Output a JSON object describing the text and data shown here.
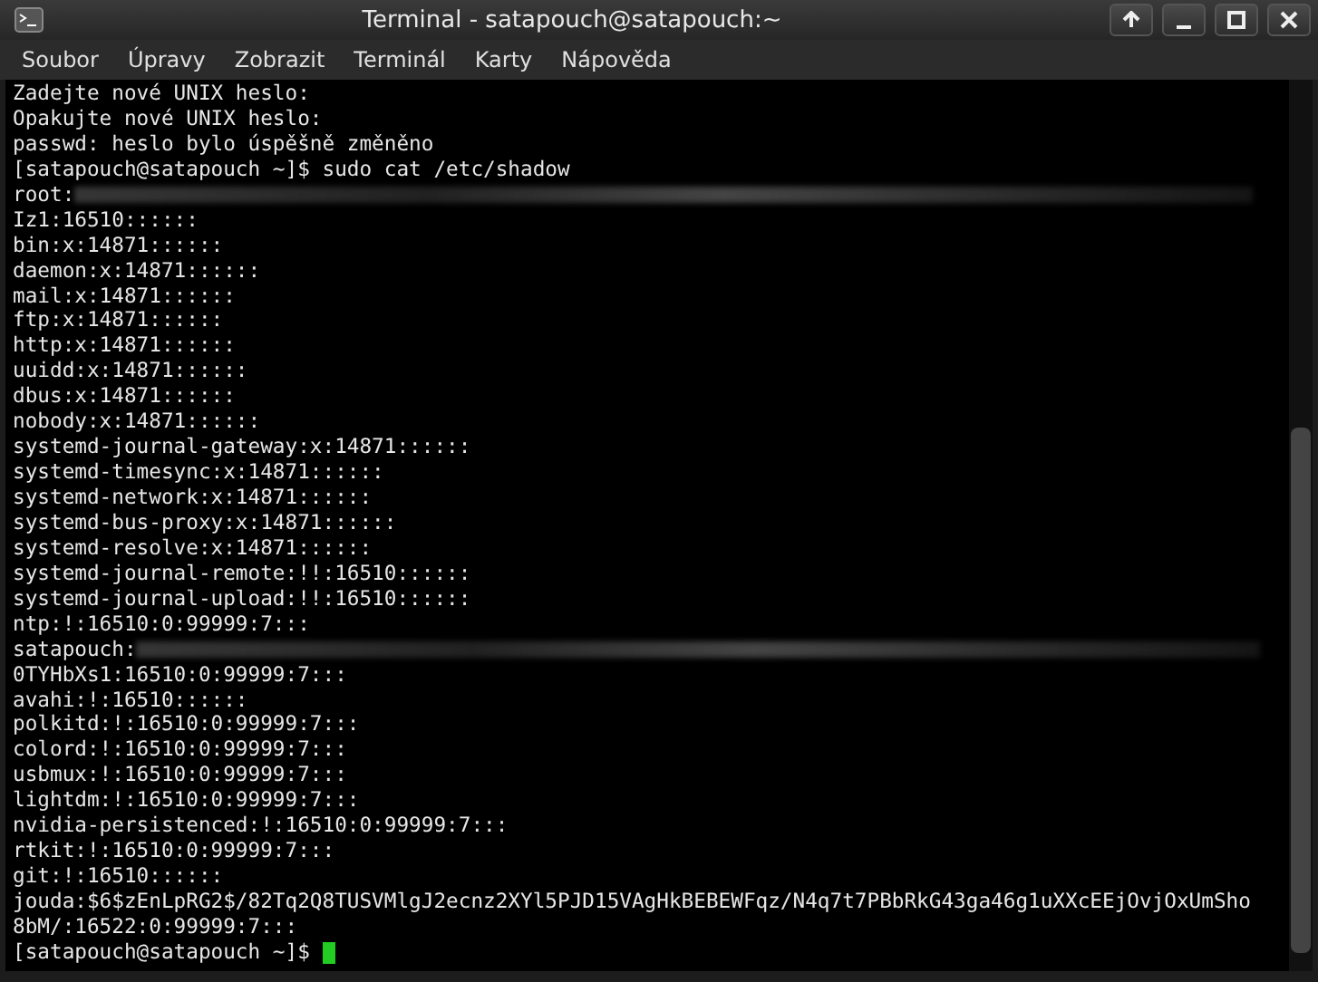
{
  "window": {
    "title": "Terminal - satapouch@satapouch:~"
  },
  "menu": [
    "Soubor",
    "Úpravy",
    "Zobrazit",
    "Terminál",
    "Karty",
    "Nápověda"
  ],
  "lines": [
    {
      "kind": "plain",
      "text": "Zadejte nové UNIX heslo:"
    },
    {
      "kind": "plain",
      "text": "Opakujte nové UNIX heslo:"
    },
    {
      "kind": "plain",
      "text": "passwd: heslo bylo úspěšně změněno"
    },
    {
      "kind": "plain",
      "text": "[satapouch@satapouch ~]$ sudo cat /etc/shadow"
    },
    {
      "kind": "redacted",
      "text": "root:"
    },
    {
      "kind": "plain",
      "text": "Iz1:16510::::::"
    },
    {
      "kind": "plain",
      "text": "bin:x:14871::::::"
    },
    {
      "kind": "plain",
      "text": "daemon:x:14871::::::"
    },
    {
      "kind": "plain",
      "text": "mail:x:14871::::::"
    },
    {
      "kind": "plain",
      "text": "ftp:x:14871::::::"
    },
    {
      "kind": "plain",
      "text": "http:x:14871::::::"
    },
    {
      "kind": "plain",
      "text": "uuidd:x:14871::::::"
    },
    {
      "kind": "plain",
      "text": "dbus:x:14871::::::"
    },
    {
      "kind": "plain",
      "text": "nobody:x:14871::::::"
    },
    {
      "kind": "plain",
      "text": "systemd-journal-gateway:x:14871::::::"
    },
    {
      "kind": "plain",
      "text": "systemd-timesync:x:14871::::::"
    },
    {
      "kind": "plain",
      "text": "systemd-network:x:14871::::::"
    },
    {
      "kind": "plain",
      "text": "systemd-bus-proxy:x:14871::::::"
    },
    {
      "kind": "plain",
      "text": "systemd-resolve:x:14871::::::"
    },
    {
      "kind": "plain",
      "text": "systemd-journal-remote:!!:16510::::::"
    },
    {
      "kind": "plain",
      "text": "systemd-journal-upload:!!:16510::::::"
    },
    {
      "kind": "plain",
      "text": "ntp:!:16510:0:99999:7:::"
    },
    {
      "kind": "redacted",
      "text": "satapouch:"
    },
    {
      "kind": "plain",
      "text": "0TYHbXs1:16510:0:99999:7:::"
    },
    {
      "kind": "plain",
      "text": "avahi:!:16510::::::"
    },
    {
      "kind": "plain",
      "text": "polkitd:!:16510:0:99999:7:::"
    },
    {
      "kind": "plain",
      "text": "colord:!:16510:0:99999:7:::"
    },
    {
      "kind": "plain",
      "text": "usbmux:!:16510:0:99999:7:::"
    },
    {
      "kind": "plain",
      "text": "lightdm:!:16510:0:99999:7:::"
    },
    {
      "kind": "plain",
      "text": "nvidia-persistenced:!:16510:0:99999:7:::"
    },
    {
      "kind": "plain",
      "text": "rtkit:!:16510:0:99999:7:::"
    },
    {
      "kind": "plain",
      "text": "git:!:16510::::::"
    },
    {
      "kind": "plain",
      "text": "jouda:$6$zEnLpRG2$/82Tq2Q8TUSVMlgJ2ecnz2XYl5PJD15VAgHkBEBEWFqz/N4q7t7PBbRkG43ga46g1uXXcEEjOvjOxUmSho"
    },
    {
      "kind": "plain",
      "text": "8bM/:16522:0:99999:7:::"
    },
    {
      "kind": "cursor",
      "text": "[satapouch@satapouch ~]$"
    }
  ]
}
